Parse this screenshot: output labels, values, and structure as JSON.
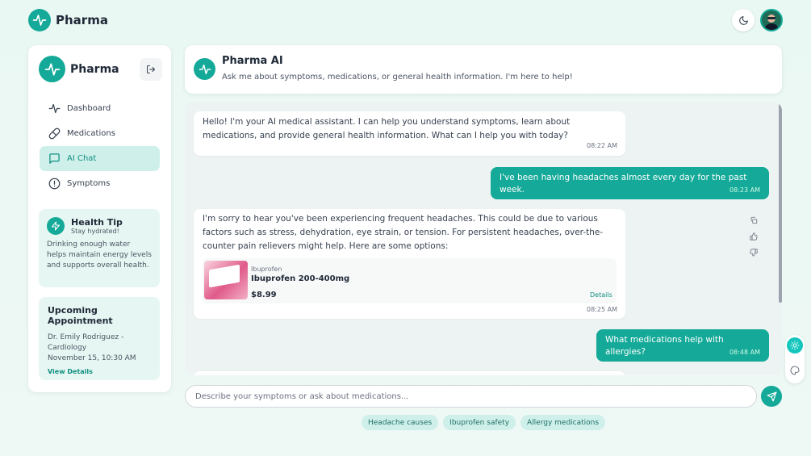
{
  "app": {
    "name": "Pharma"
  },
  "sidebar": {
    "title": "Pharma",
    "nav": [
      {
        "label": "Dashboard",
        "icon": "activity-icon"
      },
      {
        "label": "Medications",
        "icon": "pill-icon"
      },
      {
        "label": "AI Chat",
        "icon": "chat-icon",
        "active": true
      },
      {
        "label": "Symptoms",
        "icon": "alert-circle-icon"
      }
    ],
    "health_tip": {
      "title": "Health Tip",
      "subtitle": "Stay hydrated!",
      "body": "Drinking enough water helps maintain energy levels and supports overall health."
    },
    "appointment": {
      "title": "Upcoming Appointment",
      "doctor": "Dr. Emily Rodriguez - Cardiology",
      "datetime": "November 15, 10:30 AM",
      "link": "View Details"
    }
  },
  "chat_header": {
    "title": "Pharma AI",
    "subtitle": "Ask me about symptoms, medications, or general health information. I'm here to help!"
  },
  "messages": [
    {
      "role": "ai",
      "text": "Hello! I'm your AI medical assistant. I can help you understand symptoms, learn about medications, and provide general health information. What can I help you with today?",
      "time": "08:22 AM"
    },
    {
      "role": "user",
      "text": "I've been having headaches almost every day for the past week.",
      "time": "08:23 AM"
    },
    {
      "role": "ai",
      "text": "I'm sorry to hear you've been experiencing frequent headaches. This could be due to various factors such as stress, dehydration, eye strain, or tension. For persistent headaches, over-the-counter pain relievers might help. Here are some options:",
      "time": "08:25 AM",
      "product": {
        "brand": "Ibuprofen",
        "name": "Ibuprofen 200-400mg",
        "price": "$8.99",
        "details": "Details"
      }
    },
    {
      "role": "user",
      "text": "What medications help with allergies?",
      "time": "08:48 AM"
    }
  ],
  "input": {
    "placeholder": "Describe your symptoms or ask about medications..."
  },
  "suggestions": [
    "Headache causes",
    "Ibuprofen safety",
    "Allergy medications"
  ],
  "colors": {
    "accent": "#14a998",
    "background": "#eaf8f4"
  }
}
